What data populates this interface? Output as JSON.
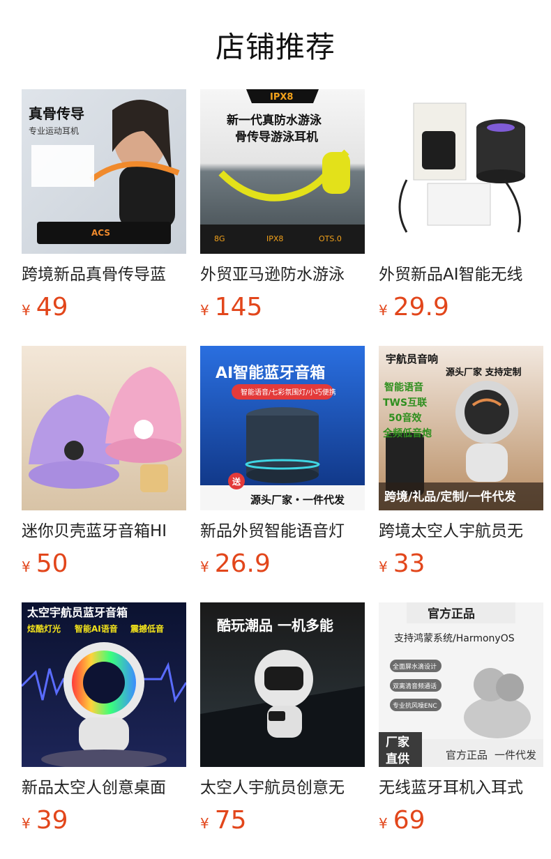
{
  "page": {
    "title": "店铺推荐"
  },
  "products": [
    {
      "name": "跨境新品真骨传导蓝",
      "currency": "¥",
      "price": "49",
      "image": {
        "lines": [
          "真骨传导",
          "专业运动耳机"
        ],
        "badges": [
          "ACS"
        ]
      }
    },
    {
      "name": "外贸亚马逊防水游泳",
      "currency": "¥",
      "price": "145",
      "image": {
        "lines": [
          "IPX8",
          "新一代真防水游泳",
          "骨传导游泳耳机"
        ],
        "badges": [
          "8G",
          "IPX8",
          "OTS.0"
        ]
      }
    },
    {
      "name": "外贸新品AI智能无线",
      "currency": "¥",
      "price": "29.9",
      "image": {
        "lines": [],
        "badges": []
      }
    },
    {
      "name": "迷你贝壳蓝牙音箱HI",
      "currency": "¥",
      "price": "50",
      "image": {
        "lines": [],
        "badges": []
      }
    },
    {
      "name": "新品外贸智能语音灯",
      "currency": "¥",
      "price": "26.9",
      "image": {
        "lines": [
          "AI智能蓝牙音箱",
          "智能语音/七彩氛围灯/小巧便携",
          "送",
          "源头厂家・一件代发"
        ],
        "badges": []
      }
    },
    {
      "name": "跨境太空人宇航员无",
      "currency": "¥",
      "price": "33",
      "image": {
        "lines": [
          "宇航员音响",
          "源头厂家 支持定制",
          "智能语音",
          "TWS互联",
          "50音效",
          "全频低音炮",
          "跨境/礼品/定制/一件代发"
        ],
        "badges": []
      }
    },
    {
      "name": "新品太空人创意桌面",
      "currency": "¥",
      "price": "39",
      "image": {
        "lines": [
          "太空宇航员蓝牙音箱",
          "炫酷灯光",
          "智能AI语音",
          "震撼低音"
        ],
        "badges": []
      }
    },
    {
      "name": "太空人宇航员创意无",
      "currency": "¥",
      "price": "75",
      "image": {
        "lines": [
          "酷玩潮品 一机多能"
        ],
        "badges": []
      }
    },
    {
      "name": "无线蓝牙耳机入耳式",
      "currency": "¥",
      "price": "69",
      "image": {
        "lines": [
          "官方正品",
          "支持鸿蒙系统/HarmonyOS",
          "全面屏水滴设计",
          "双离清音频通话",
          "专业抗风噪ENC",
          "厂家",
          "直供",
          "官方正品",
          "一件代发"
        ],
        "badges": []
      }
    }
  ],
  "colors": {
    "price": "#e2461b",
    "title": "#111111"
  }
}
